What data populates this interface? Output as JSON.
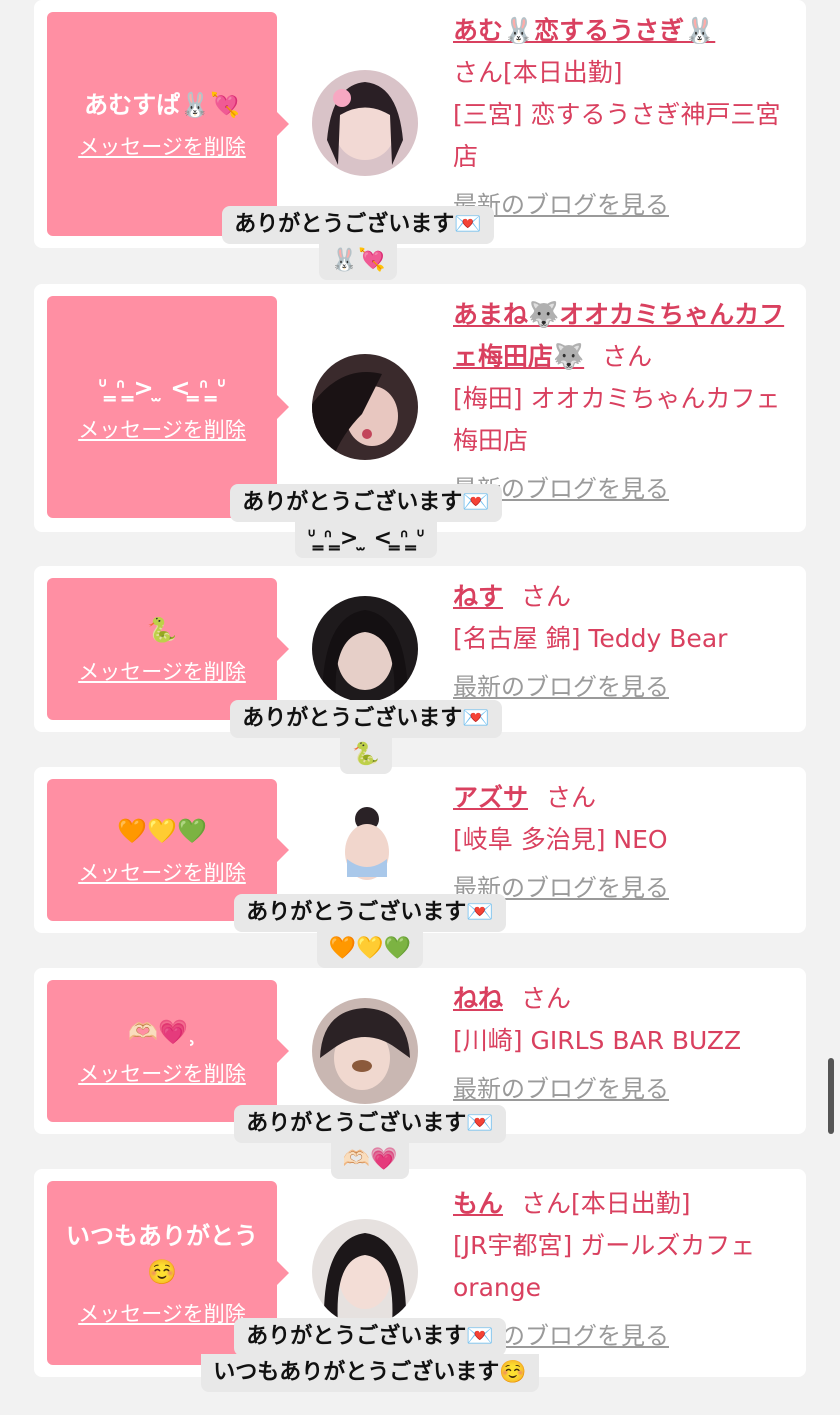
{
  "cards": [
    {
      "message": "あむすぱ🐰💘",
      "delete_label": "メッセージを削除",
      "name": "あむ🐰恋するうさぎ🐰",
      "suffix": "さん",
      "status": "[本日出勤]",
      "shop": "[三宮] 恋するうさぎ神戸三宮店",
      "blog_label": "最新のブログを見る",
      "toast_line1": "ありがとうございます💌",
      "toast_line2": "🐰💘"
    },
    {
      "message": "ᐡ ̳ᐢ ̳> ̫ < ̳ᐢ ̳ᐡ",
      "delete_label": "メッセージを削除",
      "name": "あまね🐺オオカミちゃんカフェ梅田店🐺",
      "suffix": "さん",
      "status": "",
      "shop": "[梅田] オオカミちゃんカフェ梅田店",
      "blog_label": "最新のブログを見る",
      "toast_line1": "ありがとうございます💌",
      "toast_line2": "ᐡ ̳ᐢ ̳> ̫ < ̳ᐢ ̳ᐡ"
    },
    {
      "message": "🐍",
      "delete_label": "メッセージを削除",
      "name": "ねす",
      "suffix": "さん",
      "status": "",
      "shop": "[名古屋 錦] Teddy Bear",
      "blog_label": "最新のブログを見る",
      "toast_line1": "ありがとうございます💌",
      "toast_line2": "🐍"
    },
    {
      "message": "🧡💛💚",
      "delete_label": "メッセージを削除",
      "name": "アズサ",
      "suffix": "さん",
      "status": "",
      "shop": "[岐阜 多治見] NEO",
      "blog_label": "最新のブログを見る",
      "toast_line1": "ありがとうございます💌",
      "toast_line2": "🧡💛💚"
    },
    {
      "message": "🫶🏻💗⸒",
      "delete_label": "メッセージを削除",
      "name": "ねね",
      "suffix": "さん",
      "status": "",
      "shop": "[川崎] GIRLS BAR BUZZ",
      "blog_label": "最新のブログを見る",
      "toast_line1": "ありがとうございます💌",
      "toast_line2": "🫶🏻💗"
    },
    {
      "message": "いつもありがとう☺️",
      "delete_label": "メッセージを削除",
      "name": "もん",
      "suffix": "さん",
      "status": "[本日出勤]",
      "shop": "[JR宇都宮] ガールズカフェorange",
      "blog_label": "最新のブログを見る",
      "toast_line1": "ありがとうございます💌",
      "toast_line2": "いつもありがとうございます☺️"
    }
  ],
  "colors": {
    "bubble": "#ff8fa3",
    "accent": "#d9405f",
    "muted": "#9a9a9a"
  }
}
